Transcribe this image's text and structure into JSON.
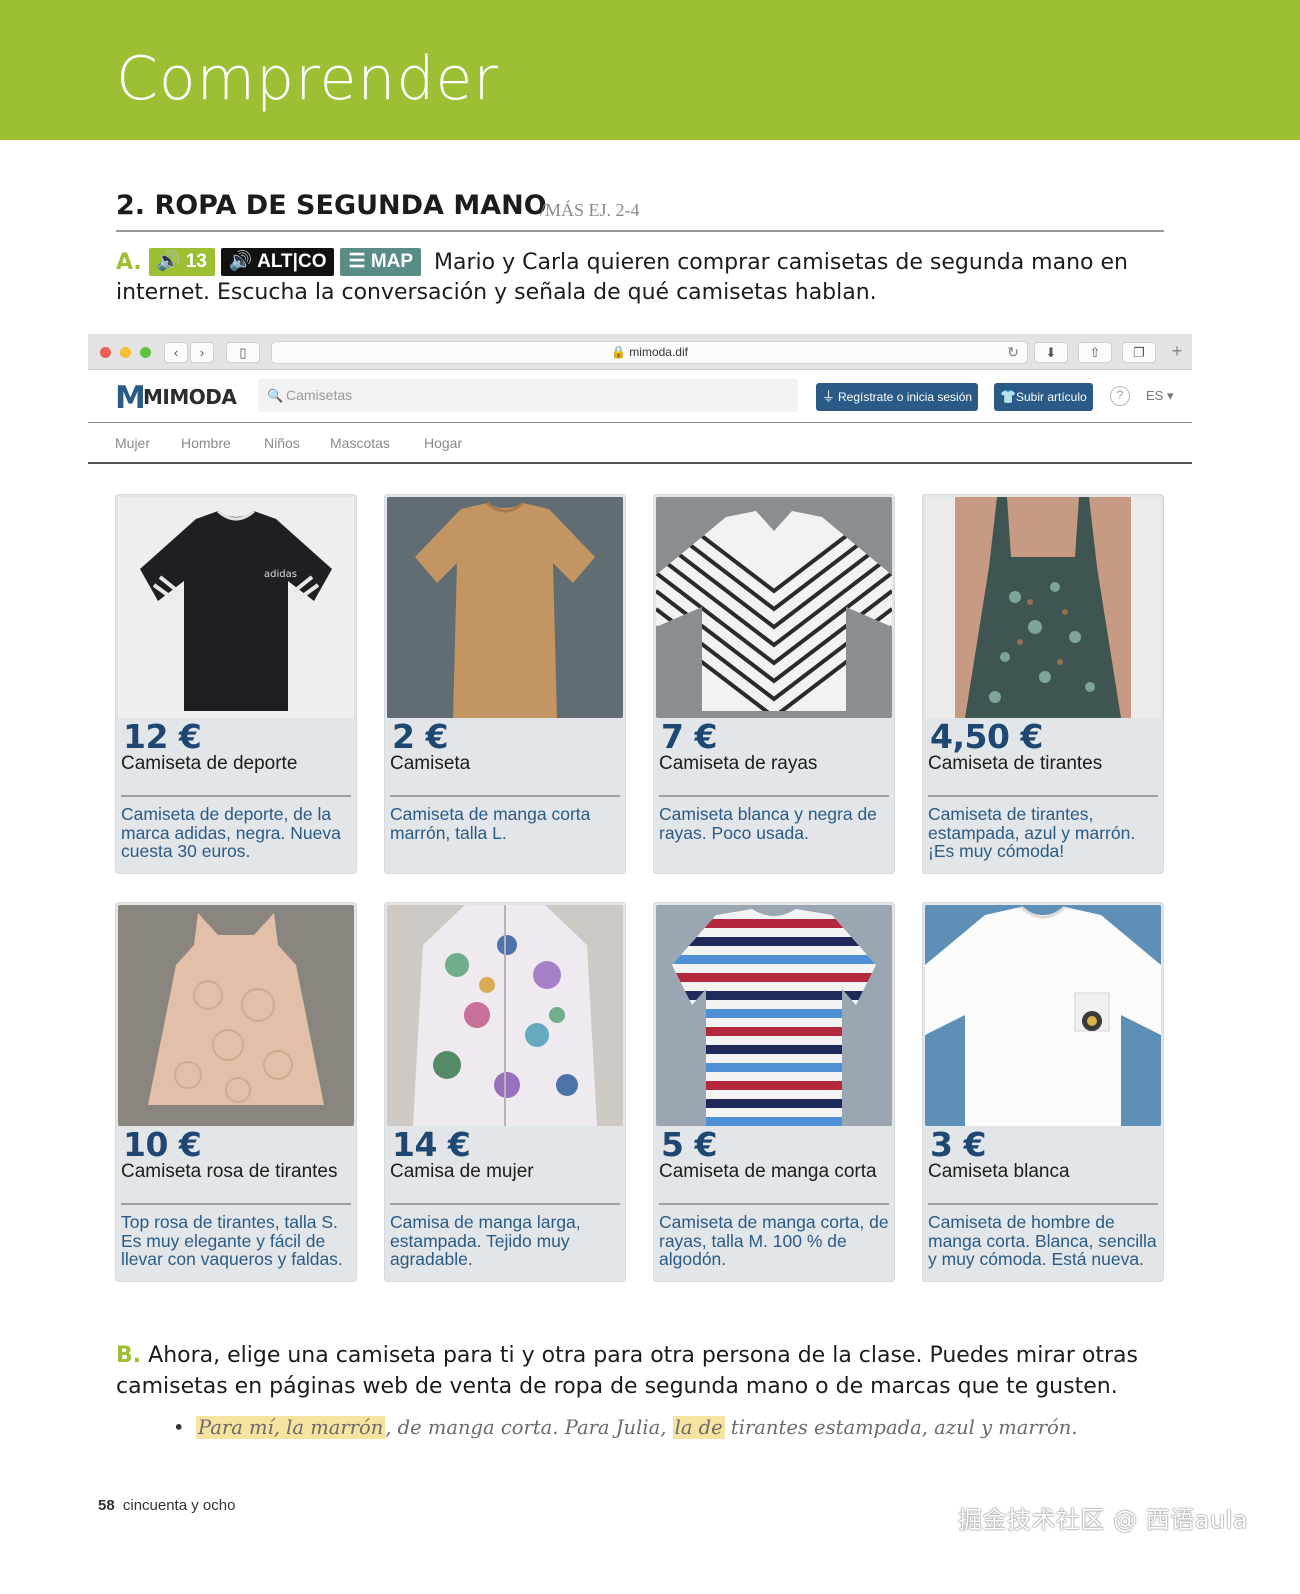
{
  "header": {
    "title": "Comprender"
  },
  "section": {
    "title": "2.  ROPA DE SEGUNDA MANO",
    "ref": "/MÁS EJ. 2-4"
  },
  "instruction_a": {
    "letter": "A.",
    "audio_tag": "13",
    "altco_tag": "ALT|CO",
    "map_tag": "MAP",
    "text": "Mario y Carla quieren comprar camisetas de segunda mano en internet. Escucha la conversación y señala de qué camisetas hablan."
  },
  "browser": {
    "url": "mimoda.dif",
    "logo_mark": "M",
    "logo_text": "MIMODA",
    "search_placeholder": "Camisetas",
    "register_button": "Regístrate o inicia sesión",
    "upload_button": "Subir artículo",
    "help": "?",
    "language": "ES",
    "categories": [
      "Mujer",
      "Hombre",
      "Niños",
      "Mascotas",
      "Hogar"
    ],
    "icons": [
      "back-icon",
      "forward-icon",
      "sidebar-icon",
      "lock-icon",
      "reload-icon",
      "download-icon",
      "share-icon",
      "tabs-icon",
      "plus-icon"
    ]
  },
  "products": [
    {
      "price": "12 €",
      "title": "Camiseta de deporte",
      "desc": "Camiseta de deporte, de la marca adidas, negra. Nueva cuesta 30 euros."
    },
    {
      "price": "2 €",
      "title": "Camiseta",
      "desc": "Camiseta de manga corta marrón, talla L."
    },
    {
      "price": "7 €",
      "title": "Camiseta de rayas",
      "desc": "Camiseta blanca y negra de rayas. Poco usada."
    },
    {
      "price": "4,50 €",
      "title": "Camiseta de tirantes",
      "desc": "Camiseta de tirantes, estampada, azul y marrón. ¡Es muy cómoda!"
    },
    {
      "price": "10 €",
      "title": "Camiseta rosa de tirantes",
      "desc": "Top rosa de tirantes, talla S. Es muy elegante y fácil de llevar con vaqueros y faldas."
    },
    {
      "price": "14 €",
      "title": "Camisa de mujer",
      "desc": "Camisa de manga larga, estampada. Tejido muy agradable."
    },
    {
      "price": "5 €",
      "title": "Camiseta de manga corta",
      "desc": "Camiseta de manga corta, de rayas, talla M. 100 % de algodón."
    },
    {
      "price": "3 €",
      "title": "Camiseta blanca",
      "desc": "Camiseta de hombre de manga corta. Blanca, sencilla y muy cómoda. Está nueva."
    }
  ],
  "instruction_b": {
    "letter": "B.",
    "text": "Ahora, elige una camiseta para ti y otra para otra persona de la clase. Puedes mirar otras camisetas en páginas web de venta de ropa de segunda mano o de marcas que te gusten."
  },
  "example": {
    "bullet": "•",
    "highlight1": "Para mí, la marrón",
    "part2": ", de manga corta. Para Julia, ",
    "highlight2": "la de",
    "part3": " tirantes estampada, azul y marrón."
  },
  "footer": {
    "page_number": "58",
    "page_words": "cincuenta y ocho"
  },
  "watermark": "掘金技术社区 @ 西语aula",
  "colors": {
    "band": "#9dbf34",
    "brand_blue": "#2a5b87",
    "price_blue": "#1e4872",
    "map_tag": "#5a8c86",
    "highlight": "#f6e3a0"
  }
}
